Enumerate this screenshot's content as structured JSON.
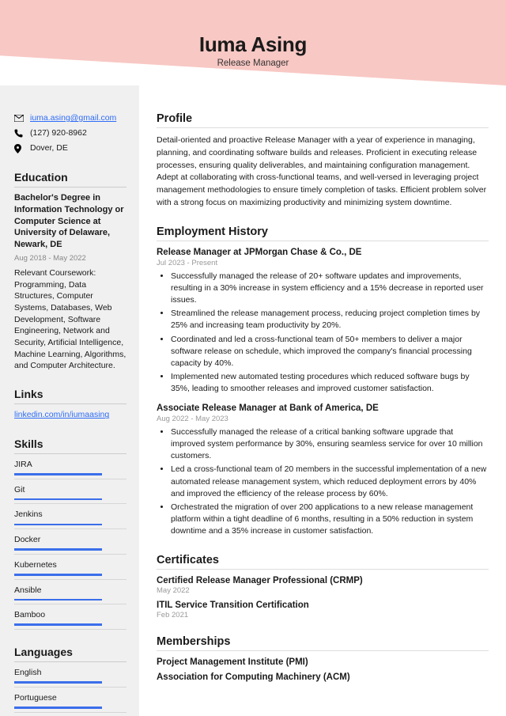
{
  "header": {
    "name": "Iuma Asing",
    "title": "Release Manager"
  },
  "contact": {
    "email": "iuma.asing@gmail.com",
    "phone": "(127) 920-8962",
    "location": "Dover, DE"
  },
  "education": {
    "heading": "Education",
    "degree": "Bachelor's Degree in Information Technology or Computer Science at University of Delaware, Newark, DE",
    "period": "Aug 2018 - May 2022",
    "coursework": "Relevant Coursework: Programming, Data Structures, Computer Systems, Databases, Web Development, Software Engineering, Network and Security, Artificial Intelligence, Machine Learning, Algorithms, and Computer Architecture."
  },
  "links": {
    "heading": "Links",
    "items": [
      "linkedin.com/in/iumaasing"
    ]
  },
  "skills": {
    "heading": "Skills",
    "items": [
      "JIRA",
      "Git",
      "Jenkins",
      "Docker",
      "Kubernetes",
      "Ansible",
      "Bamboo"
    ]
  },
  "languages": {
    "heading": "Languages",
    "items": [
      "English",
      "Portuguese"
    ]
  },
  "profile": {
    "heading": "Profile",
    "text": "Detail-oriented and proactive Release Manager with a year of experience in managing, planning, and coordinating software builds and releases. Proficient in executing release processes, ensuring quality deliverables, and maintaining configuration management. Adept at collaborating with cross-functional teams, and well-versed in leveraging project management methodologies to ensure timely completion of tasks. Efficient problem solver with a strong focus on maximizing productivity and minimizing system downtime."
  },
  "employment": {
    "heading": "Employment History",
    "jobs": [
      {
        "title": "Release Manager at JPMorgan Chase & Co., DE",
        "period": "Jul 2023 - Present",
        "bullets": [
          "Successfully managed the release of 20+ software updates and improvements, resulting in a 30% increase in system efficiency and a 15% decrease in reported user issues.",
          "Streamlined the release management process, reducing project completion times by 25% and increasing team productivity by 20%.",
          "Coordinated and led a cross-functional team of 50+ members to deliver a major software release on schedule, which improved the company's financial processing capacity by 40%.",
          "Implemented new automated testing procedures which reduced software bugs by 35%, leading to smoother releases and improved customer satisfaction."
        ]
      },
      {
        "title": "Associate Release Manager at Bank of America, DE",
        "period": "Aug 2022 - May 2023",
        "bullets": [
          "Successfully managed the release of a critical banking software upgrade that improved system performance by 30%, ensuring seamless service for over 10 million customers.",
          "Led a cross-functional team of 20 members in the successful implementation of a new automated release management system, which reduced deployment errors by 40% and improved the efficiency of the release process by 60%.",
          "Orchestrated the migration of over 200 applications to a new release management platform within a tight deadline of 6 months, resulting in a 50% reduction in system downtime and a 35% increase in customer satisfaction."
        ]
      }
    ]
  },
  "certificates": {
    "heading": "Certificates",
    "items": [
      {
        "title": "Certified Release Manager Professional (CRMP)",
        "date": "May 2022"
      },
      {
        "title": "ITIL Service Transition Certification",
        "date": "Feb 2021"
      }
    ]
  },
  "memberships": {
    "heading": "Memberships",
    "items": [
      "Project Management Institute (PMI)",
      "Association for Computing Machinery (ACM)"
    ]
  }
}
